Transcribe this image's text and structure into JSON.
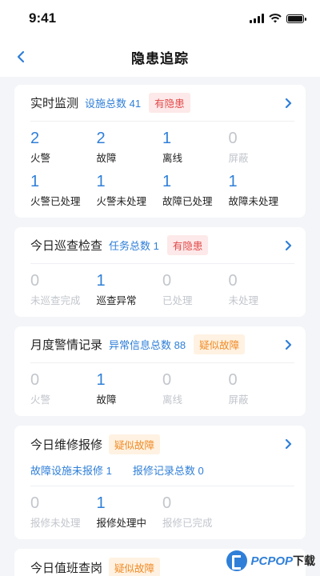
{
  "status_bar": {
    "time": "9:41"
  },
  "nav": {
    "title": "隐患追踪"
  },
  "cards": {
    "realtime": {
      "title": "实时监测",
      "meta": "设施总数 41",
      "badge": "有隐患",
      "stats": [
        {
          "value": "2",
          "label": "火警"
        },
        {
          "value": "2",
          "label": "故障"
        },
        {
          "value": "1",
          "label": "离线"
        },
        {
          "value": "0",
          "label": "屏蔽"
        },
        {
          "value": "1",
          "label": "火警已处理"
        },
        {
          "value": "1",
          "label": "火警未处理"
        },
        {
          "value": "1",
          "label": "故障已处理"
        },
        {
          "value": "1",
          "label": "故障未处理"
        }
      ]
    },
    "patrol": {
      "title": "今日巡查检查",
      "meta": "任务总数 1",
      "badge": "有隐患",
      "stats": [
        {
          "value": "0",
          "label": "未巡查完成"
        },
        {
          "value": "1",
          "label": "巡查异常"
        },
        {
          "value": "0",
          "label": "已处理"
        },
        {
          "value": "0",
          "label": "未处理"
        }
      ]
    },
    "monthly": {
      "title": "月度警情记录",
      "meta": "异常信息总数 88",
      "badge": "疑似故障",
      "stats": [
        {
          "value": "0",
          "label": "火警"
        },
        {
          "value": "1",
          "label": "故障"
        },
        {
          "value": "0",
          "label": "离线"
        },
        {
          "value": "0",
          "label": "屏蔽"
        }
      ]
    },
    "repair": {
      "title": "今日维修报修",
      "badge": "疑似故障",
      "sub_meta_1": "故障设施未报修 1",
      "sub_meta_2": "报修记录总数 0",
      "stats": [
        {
          "value": "0",
          "label": "报修未处理"
        },
        {
          "value": "1",
          "label": "报修处理中"
        },
        {
          "value": "0",
          "label": "报修已完成"
        }
      ]
    },
    "duty": {
      "title": "今日值班查岗",
      "badge": "疑似故障"
    }
  },
  "watermark": {
    "brand": "PCPOP",
    "suffix": "下载"
  },
  "colors": {
    "accent": "#2f7fd8",
    "danger": "#e24a4a",
    "warning": "#f08a24",
    "muted": "#c2c6cc"
  }
}
